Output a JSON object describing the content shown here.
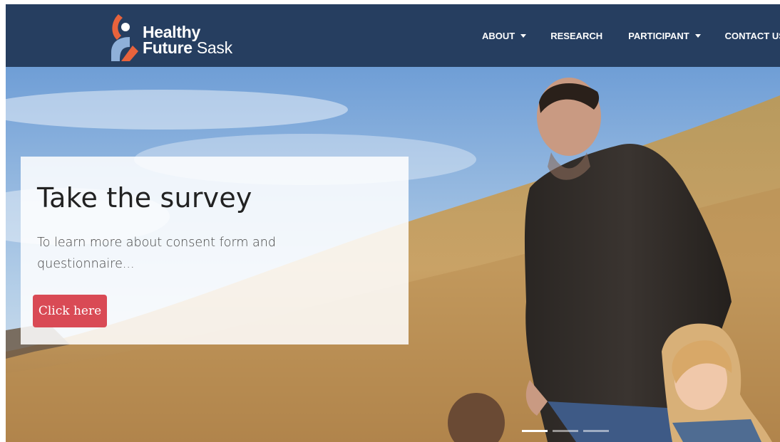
{
  "brand": {
    "name_line1": "Healthy",
    "name_line2_bold": "Future",
    "name_line2_light": "Sask"
  },
  "nav": {
    "items": [
      {
        "label": "ABOUT",
        "dropdown": true
      },
      {
        "label": "RESEARCH",
        "dropdown": false
      },
      {
        "label": "PARTICIPANT",
        "dropdown": true
      },
      {
        "label": "CONTACT US",
        "dropdown": false
      }
    ]
  },
  "hero": {
    "title": "Take the survey",
    "text": "To learn more about consent form and questionnaire...",
    "button_label": "Click here",
    "active_slide": 1,
    "slide_count": 3
  },
  "colors": {
    "navbar": "#263e60",
    "button": "#d94a55",
    "logo_orange": "#e8633c",
    "logo_blue": "#8fb0d9"
  }
}
